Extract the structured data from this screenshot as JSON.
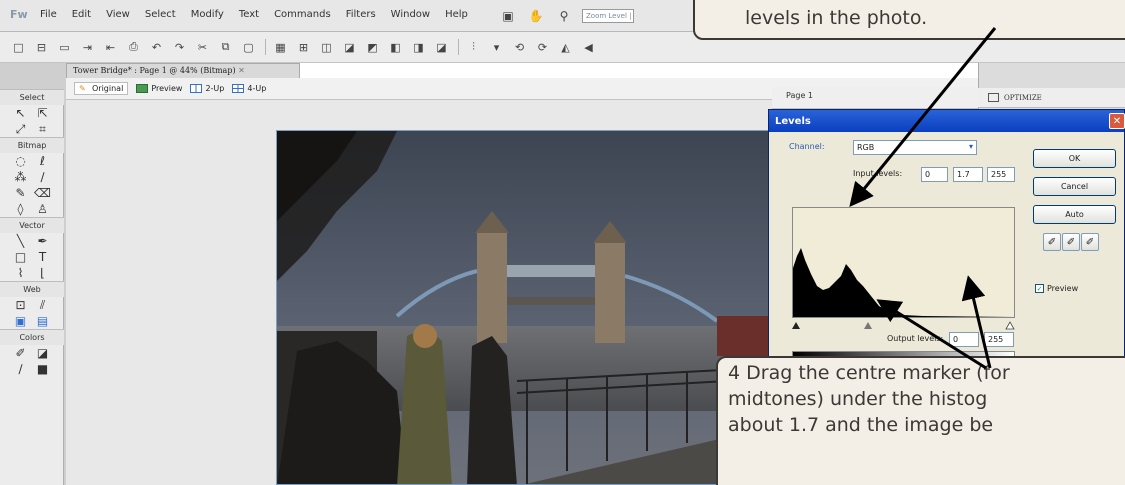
{
  "app": {
    "logo": "Fw",
    "menu": [
      "File",
      "Edit",
      "View",
      "Select",
      "Modify",
      "Text",
      "Commands",
      "Filters",
      "Window",
      "Help"
    ],
    "zoom_placeholder": "Zoom Level | ▾"
  },
  "document": {
    "tab_title": "Tower Bridge* : Page 1 @ 44% (Bitmap)",
    "view_tabs": [
      "Original",
      "Preview",
      "2-Up",
      "4-Up"
    ]
  },
  "tools_panel": {
    "groups": [
      "Select",
      "Bitmap",
      "Vector",
      "Web",
      "Colors"
    ]
  },
  "page_panel": {
    "label": "Page 1"
  },
  "optimize_panel": {
    "label": "OPTIMIZE"
  },
  "levels_dialog": {
    "title": "Levels",
    "channel_label": "Channel:",
    "channel_value": "RGB",
    "input_levels_label": "Input levels:",
    "input_levels": [
      "0",
      "1.7",
      "255"
    ],
    "output_levels_label": "Output levels:",
    "output_levels": [
      "0",
      "255"
    ],
    "buttons": {
      "ok": "OK",
      "cancel": "Cancel",
      "auto": "Auto"
    },
    "preview_label": "Preview",
    "preview_checked": true
  },
  "callouts": {
    "top": "levels in the photo.",
    "bottom_lines": [
      "4  Drag the centre marker (for",
      "    midtones) under the histog",
      "    about 1.7 and the image be"
    ]
  }
}
